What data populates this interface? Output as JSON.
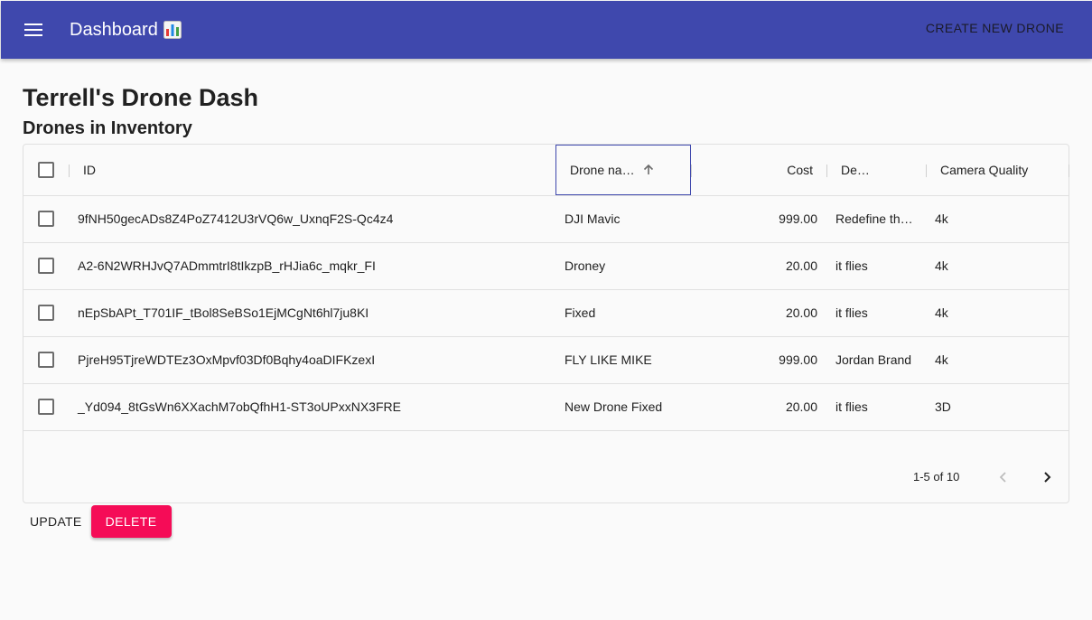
{
  "appbar": {
    "title": "Dashboard",
    "title_icon": "bar-chart-emoji-icon",
    "create_label": "CREATE NEW DRONE",
    "color": "#3f48ad"
  },
  "page": {
    "title": "Terrell's Drone Dash",
    "section_title": "Drones in Inventory"
  },
  "table": {
    "columns": {
      "id": "ID",
      "name": "Drone na…",
      "cost": "Cost",
      "description": "De…",
      "camera": "Camera Quality"
    },
    "sort_icon": "arrow-up-icon",
    "rows": [
      {
        "id": "9fNH50gecADs8Z4PoZ7412U3rVQ6w_UxnqF2S-Qc4z4",
        "name": "DJI Mavic",
        "cost": "999.00",
        "description": "Redefine th…",
        "camera": "4k"
      },
      {
        "id": "A2-6N2WRHJvQ7ADmmtrI8tIkzpB_rHJia6c_mqkr_FI",
        "name": "Droney",
        "cost": "20.00",
        "description": "it flies",
        "camera": "4k"
      },
      {
        "id": "nEpSbAPt_T701IF_tBol8SeBSo1EjMCgNt6hl7ju8KI",
        "name": "Fixed",
        "cost": "20.00",
        "description": "it flies",
        "camera": "4k"
      },
      {
        "id": "PjreH95TjreWDTEz3OxMpvf03Df0Bqhy4oaDIFKzexI",
        "name": "FLY LIKE MIKE",
        "cost": "999.00",
        "description": "Jordan Brand",
        "camera": "4k"
      },
      {
        "id": "_Yd094_8tGsWn6XXachM7obQfhH1-ST3oUPxxNX3FRE",
        "name": "New Drone Fixed",
        "cost": "20.00",
        "description": "it flies",
        "camera": "3D"
      }
    ],
    "pagination": {
      "count_label": "1-5 of 10"
    }
  },
  "actions": {
    "update_label": "UPDATE",
    "delete_label": "DELETE",
    "delete_color": "#f50c57"
  }
}
